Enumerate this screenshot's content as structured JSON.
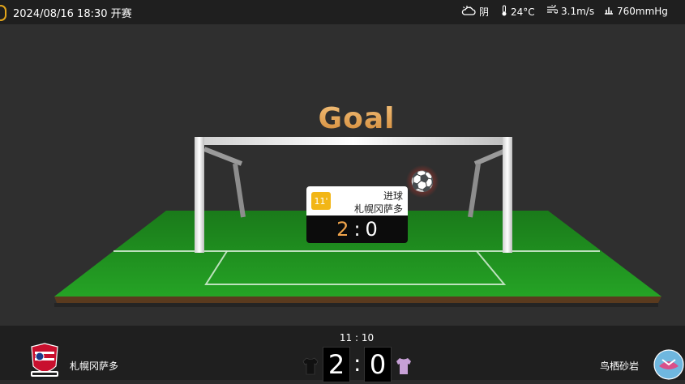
{
  "topbar": {
    "datetime": "2024/08/16 18:30 开赛",
    "weather": {
      "icon": "cloudy-icon",
      "label": "阴"
    },
    "temperature": {
      "icon": "thermometer-icon",
      "label": "24°C"
    },
    "wind": {
      "icon": "wind-icon",
      "label": "3.1m/s"
    },
    "pressure": {
      "icon": "pressure-icon",
      "label": "760mmHg"
    }
  },
  "scene": {
    "title": "Goal",
    "event": {
      "minute": "11'",
      "type": "进球",
      "team": "札幌冈萨多",
      "home_score": "2",
      "separator": ":",
      "away_score": "0"
    }
  },
  "scoreboard": {
    "clock": "11 : 10",
    "home_team": "札幌冈萨多",
    "away_team": "鸟栖砂岩",
    "home_score": "2",
    "away_score": "0",
    "separator": ":"
  },
  "colors": {
    "accent": "#f2b616",
    "score_home": "#f0a44b",
    "pitch": "#1d8a1d",
    "home_shirt": "#111111",
    "away_shirt": "#c7a0d6"
  }
}
